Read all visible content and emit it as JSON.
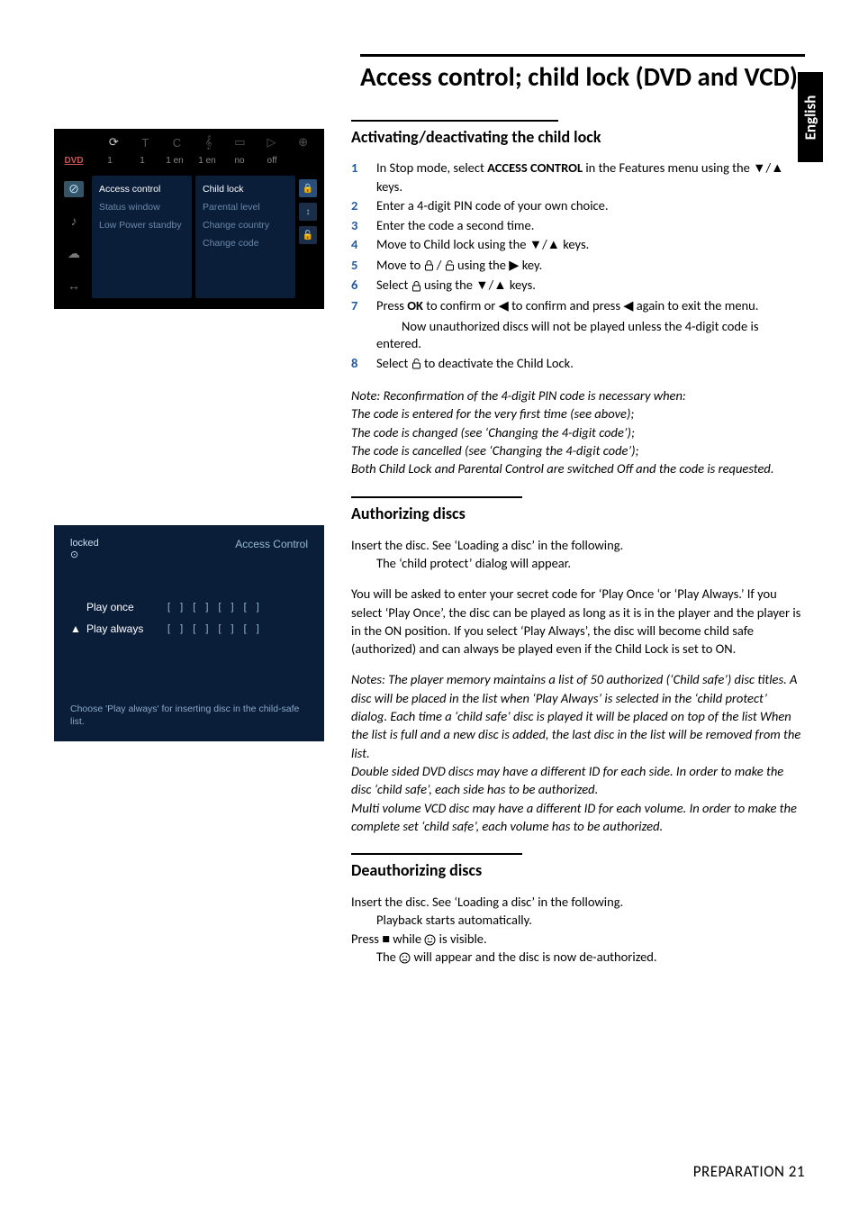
{
  "lang_tab": "English",
  "main_title": "Access control; child lock (DVD and VCD)",
  "section1": {
    "heading": "Activating/deactivating the child lock",
    "steps": [
      {
        "n": "1",
        "t": "In Stop mode, select <b>ACCESS CONTROL</b> in the Features menu using the <span class='arrow'>▼</span>/<span class='arrow'>▲</span> keys."
      },
      {
        "n": "2",
        "t": "Enter a 4-digit PIN code of your own choice."
      },
      {
        "n": "3",
        "t": "Enter the code a second time."
      },
      {
        "n": "4",
        "t": "Move to Child lock using the <span class='arrow'>▼</span>/<span class='arrow'>▲</span>  keys."
      },
      {
        "n": "5",
        "t": "Move to <svg class='icon-lock' width='11' height='12' viewBox='0 0 11 12'><rect x='1.5' y='5' width='8' height='6' rx='1' fill='none' stroke='#000' stroke-width='1'/><path d='M3 5 V3 a2.5 2.5 0 0 1 5 0 V5' fill='none' stroke='#000' stroke-width='1'/></svg> / <svg class='icon-unlock' width='11' height='12' viewBox='0 0 11 12'><rect x='1.5' y='5' width='8' height='6' rx='1' fill='none' stroke='#000' stroke-width='1'/><path d='M3 5 V3 a2.5 2.5 0 0 1 5 0' fill='none' stroke='#000' stroke-width='1'/></svg> using the <span class='arrow'>▶</span>  key."
      },
      {
        "n": "6",
        "t": "Select <svg class='icon-lock' width='11' height='12' viewBox='0 0 11 12'><rect x='1.5' y='5' width='8' height='6' rx='1' fill='none' stroke='#000' stroke-width='1'/><path d='M3 5 V3 a2.5 2.5 0 0 1 5 0 V5' fill='none' stroke='#000' stroke-width='1'/></svg> using the <span class='arrow'>▼</span>/<span class='arrow'>▲</span>  keys."
      },
      {
        "n": "7",
        "t": "Press <b>OK</b> to confirm or <span class='arrow'>◀</span> to confirm and press <span class='arrow'>◀</span> again to exit the menu.",
        "indent": "Now unauthorized discs will not be played unless the 4-digit code is entered."
      },
      {
        "n": "8",
        "t": "Select <svg class='icon-unlock' width='11' height='12' viewBox='0 0 11 12'><rect x='1.5' y='5' width='8' height='6' rx='1' fill='none' stroke='#000' stroke-width='1'/><path d='M3 5 V3 a2.5 2.5 0 0 1 5 0' fill='none' stroke='#000' stroke-width='1'/></svg> to deactivate the Child Lock."
      }
    ],
    "note": "Note: Reconfirmation of the 4-digit PIN code is necessary when:\nThe code is entered for the very first time (see above);\nThe code is changed (see ‘Changing the 4-digit code’);\nThe code is cancelled (see ‘Changing the 4-digit code’);\nBoth Child Lock and Parental Control are switched Off and the code is requested."
  },
  "section2": {
    "heading": "Authorizing discs",
    "para1": "Insert the disc. See ‘Loading a disc’ in the following.",
    "para1_indent": "The ‘child protect’ dialog will appear.",
    "para2": "You will be asked to enter your secret code for ‘Play Once ‘or ‘Play Always.’ If you select ‘Play Once’, the disc can be played as long as it is in the player and the player is in the ON position. If you select ‘Play Always’, the disc will become child safe (authorized) and can always be played even if the Child Lock is set to ON.",
    "note": "Notes: The player memory maintains a list of 50 authorized (‘Child safe’) disc titles. A disc will be placed in the list when ‘Play Always’ is selected in the ‘child protect’ dialog. Each time a ‘child safe’ disc is played it will be placed on top of the list When the list is full and a new disc is added, the last disc in the list will be removed from the list.\nDouble sided DVD discs may have a different ID for each side. In order to make the disc ‘child safe’, each side has to be authorized.\nMulti volume VCD disc may have a different ID for each volume. In order to make the complete set ‘child safe’, each volume has to be authorized."
  },
  "section3": {
    "heading": "Deauthorizing discs",
    "line1": "Insert the disc. See ‘Loading a disc’ in the following.",
    "line1_indent": "Playback starts automatically.",
    "line2_pre": "Press ",
    "line2_post": "  while ",
    "line2_end": " is visible.",
    "line3_pre": "The ",
    "line3_post": " will appear and the disc is now de-authorized."
  },
  "footer": {
    "label": "PREPARATION",
    "page": "21"
  },
  "menu_shot": {
    "top_icons": [
      "⟳",
      "T",
      "C",
      "𝄞",
      "▭",
      "▷",
      "⊕"
    ],
    "sub": {
      "dvd": "DVD",
      "cells": [
        "1",
        "1",
        "1 en",
        "1 en",
        "no",
        "off"
      ]
    },
    "left_icons": [
      "⊘",
      "♪",
      "☁",
      "↔"
    ],
    "panelA": [
      "Access control",
      "Status window",
      "Low Power standby"
    ],
    "panelB": [
      "Child lock",
      "Parental level",
      "Change country",
      "Change code"
    ]
  },
  "dialog_shot": {
    "locked": "locked",
    "title": "Access Control",
    "rows": [
      {
        "mark": "",
        "label": "Play once",
        "code": "[ ] [ ] [ ] [ ]"
      },
      {
        "mark": "▲",
        "label": "Play always",
        "code": "[ ] [ ] [ ] [ ]"
      }
    ],
    "hint": "Choose 'Play always' for inserting disc in the child-safe list."
  }
}
